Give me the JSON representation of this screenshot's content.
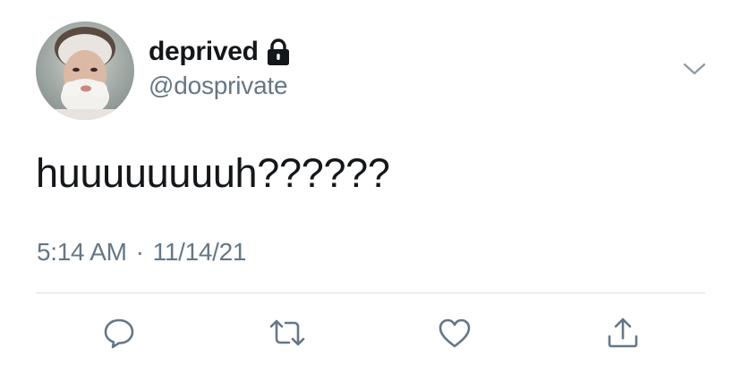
{
  "tweet": {
    "display_name": "deprived",
    "handle": "@dosprivate",
    "text": "huuuuuuuuh??????",
    "time": "5:14 AM",
    "separator": "·",
    "date": "11/14/21"
  },
  "icons": {
    "lock": "lock-icon",
    "chevron": "chevron-down-icon",
    "reply": "reply-icon",
    "retweet": "retweet-icon",
    "like": "heart-icon",
    "share": "share-icon"
  },
  "colors": {
    "primary_text": "#14171a",
    "secondary_text": "#657786",
    "divider": "#d6dde3",
    "icon": "#657786"
  }
}
